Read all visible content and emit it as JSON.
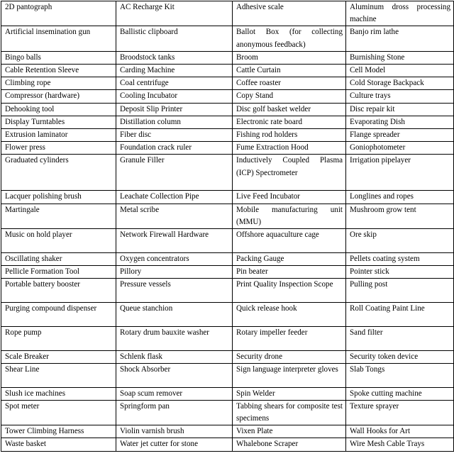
{
  "document": {
    "type": "table",
    "columns": 4,
    "rows": 28,
    "border_color": "#000000",
    "background_color": "#ffffff",
    "text_color": "#000000"
  },
  "table": {
    "rows": [
      {
        "lines": 2,
        "cells": [
          "2D pantograph",
          "AC Recharge Kit",
          "Adhesive scale",
          "Aluminum dross process⁠ing machine"
        ]
      },
      {
        "lines": 2,
        "cells": [
          "Artificial insemination gun",
          "Ballistic clipboard",
          "Ballot Box (for collecting anonymous feedback)",
          "Banjo rim lathe"
        ]
      },
      {
        "lines": 1,
        "cells": [
          "Bingo balls",
          "Broodstock tanks",
          "Broom",
          "Burnishing Stone"
        ]
      },
      {
        "lines": 1,
        "cells": [
          "Cable Retention Sleeve",
          "Carding Machine",
          "Cattle Curtain",
          "Cell Model"
        ]
      },
      {
        "lines": 1,
        "cells": [
          "Climbing rope",
          "Coal centrifuge",
          "Coffee roaster",
          "Cold Storage Backpack"
        ]
      },
      {
        "lines": 1,
        "cells": [
          "Compressor (hardware)",
          "Cooling Incubator",
          "Copy Stand",
          "Culture trays"
        ]
      },
      {
        "lines": 1,
        "cells": [
          "Dehooking tool",
          "Deposit Slip Printer",
          "Disc golf basket welder",
          "Disc repair kit"
        ]
      },
      {
        "lines": 1,
        "cells": [
          "Display Turntables",
          "Distillation column",
          "Electronic rate board",
          "Evaporating Dish"
        ]
      },
      {
        "lines": 1,
        "cells": [
          "Extrusion laminator",
          "Fiber disc",
          "Fishing rod holders",
          "Flange spreader"
        ]
      },
      {
        "lines": 1,
        "cells": [
          "Flower press",
          "Foundation crack ruler",
          "Fume Extraction Hood",
          "Goniophotometer"
        ]
      },
      {
        "lines": 3,
        "cells": [
          "Graduated cylinders",
          "Granule Filler",
          "Inductively Coupled Plasma (ICP) Spectrome­ter",
          "Irrigation pipelayer"
        ]
      },
      {
        "lines": 1,
        "cells": [
          "Lacquer polishing brush",
          "Leachate Collection Pipe",
          "Live Feed Incubator",
          "Longlines and ropes"
        ]
      },
      {
        "lines": 2,
        "cells": [
          "Martingale",
          "Metal scribe",
          "Mobile manufacturing unit (MMU)",
          "Mushroom grow tent"
        ]
      },
      {
        "lines": 2,
        "cells": [
          "Music on hold player",
          "Network Firewall Hard­ware",
          "Offshore aquaculture cage",
          "Ore skip"
        ]
      },
      {
        "lines": 1,
        "cells": [
          "Oscillating shaker",
          "Oxygen concentrators",
          "Packing Gauge",
          "Pellets coating system"
        ]
      },
      {
        "lines": 1,
        "cells": [
          "Pellicle Formation Tool",
          "Pillory",
          "Pin beater",
          "Pointer stick"
        ]
      },
      {
        "lines": 2,
        "cells": [
          "Portable battery booster",
          "Pressure vessels",
          "Print Quality Inspection Scope",
          "Pulling post"
        ]
      },
      {
        "lines": 2,
        "cells": [
          "Purging compound dis­penser",
          "Queue stanchion",
          "Quick release hook",
          "Roll Coating Paint Line"
        ]
      },
      {
        "lines": 2,
        "cells": [
          "Rope pump",
          "Rotary drum bauxite washer",
          "Rotary impeller feeder",
          "Sand filter"
        ]
      },
      {
        "lines": 1,
        "cells": [
          "Scale Breaker",
          "Schlenk flask",
          "Security drone",
          "Security token device"
        ]
      },
      {
        "lines": 2,
        "cells": [
          "Shear Line",
          "Shock Absorber",
          "Sign language interpreter gloves",
          "Slab Tongs"
        ]
      },
      {
        "lines": 1,
        "cells": [
          "Slush ice machines",
          "Soap scum remover",
          "Spin Welder",
          "Spoke cutting machine"
        ]
      },
      {
        "lines": 2,
        "cells": [
          "Spot meter",
          "Springform pan",
          "Tabbing shears for com­posite test specimens",
          "Texture sprayer"
        ]
      },
      {
        "lines": 1,
        "cells": [
          "Tower Climbing Harness",
          "Violin varnish brush",
          "Vixen Plate",
          "Wall Hooks for Art"
        ]
      },
      {
        "lines": 1,
        "cells": [
          "Waste basket",
          "Water jet cutter for stone",
          "Whalebone Scraper",
          "Wire Mesh Cable Trays"
        ]
      }
    ]
  }
}
